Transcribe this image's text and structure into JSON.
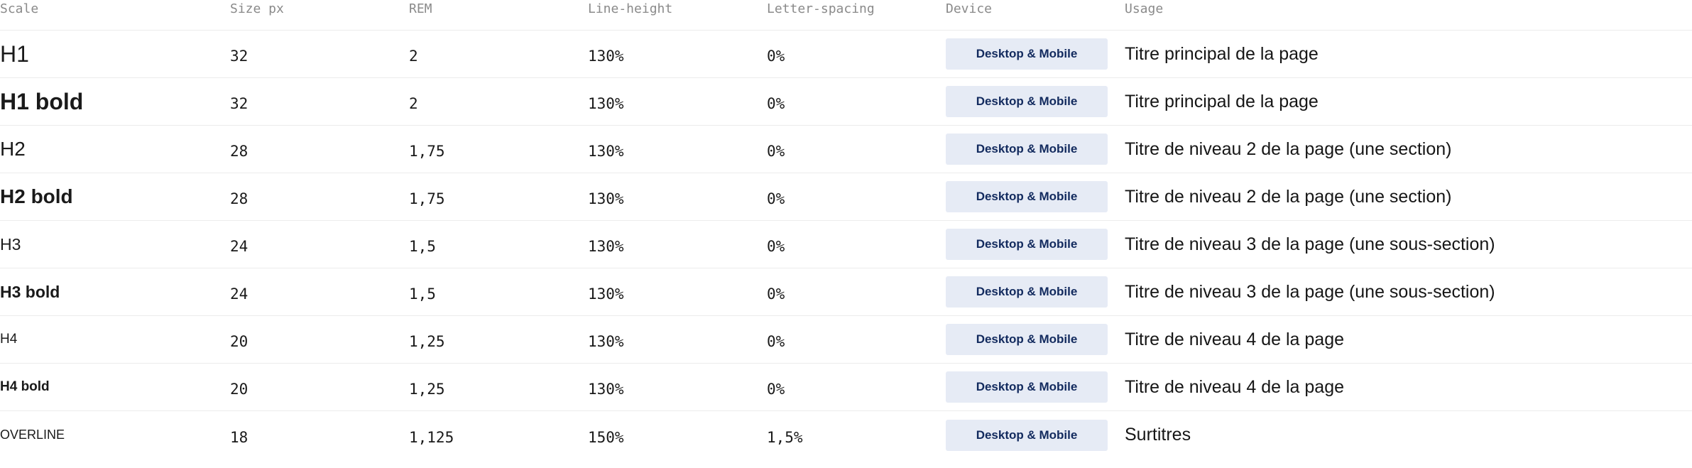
{
  "headers": {
    "scale": "Scale",
    "size_px": "Size px",
    "rem": "REM",
    "line_height": "Line-height",
    "letter_spacing": "Letter-spacing",
    "device": "Device",
    "usage": "Usage"
  },
  "rows": [
    {
      "scale": "H1",
      "size_px": "32",
      "rem": "2",
      "line_height": "130%",
      "letter_spacing": "0%",
      "device": "Desktop & Mobile",
      "usage": "Titre principal de la page"
    },
    {
      "scale": "H1 bold",
      "size_px": "32",
      "rem": "2",
      "line_height": "130%",
      "letter_spacing": "0%",
      "device": "Desktop & Mobile",
      "usage": "Titre principal de la page"
    },
    {
      "scale": "H2",
      "size_px": "28",
      "rem": "1,75",
      "line_height": "130%",
      "letter_spacing": "0%",
      "device": "Desktop & Mobile",
      "usage": "Titre de niveau 2 de la page (une section)"
    },
    {
      "scale": "H2 bold",
      "size_px": "28",
      "rem": "1,75",
      "line_height": "130%",
      "letter_spacing": "0%",
      "device": "Desktop & Mobile",
      "usage": "Titre de niveau 2 de la page (une section)"
    },
    {
      "scale": "H3",
      "size_px": "24",
      "rem": "1,5",
      "line_height": "130%",
      "letter_spacing": "0%",
      "device": "Desktop & Mobile",
      "usage": "Titre de niveau 3 de la page (une sous-section)"
    },
    {
      "scale": "H3 bold",
      "size_px": "24",
      "rem": "1,5",
      "line_height": "130%",
      "letter_spacing": "0%",
      "device": "Desktop & Mobile",
      "usage": "Titre de niveau 3 de la page (une sous-section)"
    },
    {
      "scale": "H4",
      "size_px": "20",
      "rem": "1,25",
      "line_height": "130%",
      "letter_spacing": "0%",
      "device": "Desktop & Mobile",
      "usage": "Titre de niveau 4 de la page"
    },
    {
      "scale": "H4 bold",
      "size_px": "20",
      "rem": "1,25",
      "line_height": "130%",
      "letter_spacing": "0%",
      "device": "Desktop & Mobile",
      "usage": "Titre de niveau 4 de la page"
    },
    {
      "scale": "OVERLINE",
      "size_px": "18",
      "rem": "1,125",
      "line_height": "150%",
      "letter_spacing": "1,5%",
      "device": "Desktop & Mobile",
      "usage": "Surtitres"
    }
  ],
  "colors": {
    "badge_bg": "#e6ebf5",
    "badge_text": "#122a5e",
    "header_text": "#8a8a8a",
    "divider": "#ececec"
  }
}
